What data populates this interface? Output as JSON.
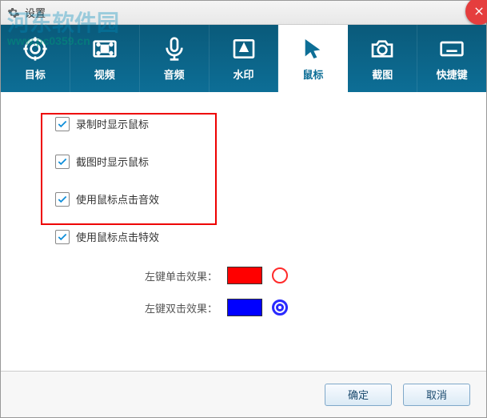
{
  "window": {
    "title": "设置"
  },
  "watermark": {
    "text": "河东软件园",
    "url": "www.pc0359.cn"
  },
  "tabs": [
    {
      "label": "目标"
    },
    {
      "label": "视频"
    },
    {
      "label": "音频"
    },
    {
      "label": "水印"
    },
    {
      "label": "鼠标"
    },
    {
      "label": "截图"
    },
    {
      "label": "快捷键"
    }
  ],
  "options": {
    "show_cursor_record": "录制时显示鼠标",
    "show_cursor_capture": "截图时显示鼠标",
    "click_sound": "使用鼠标点击音效",
    "click_effect": "使用鼠标点击特效"
  },
  "colors": {
    "left_click_label": "左键单击效果：",
    "left_dblclick_label": "左键双击效果：",
    "left_click_color": "#ff0000",
    "left_dblclick_color": "#0000ff"
  },
  "buttons": {
    "ok": "确定",
    "cancel": "取消"
  }
}
